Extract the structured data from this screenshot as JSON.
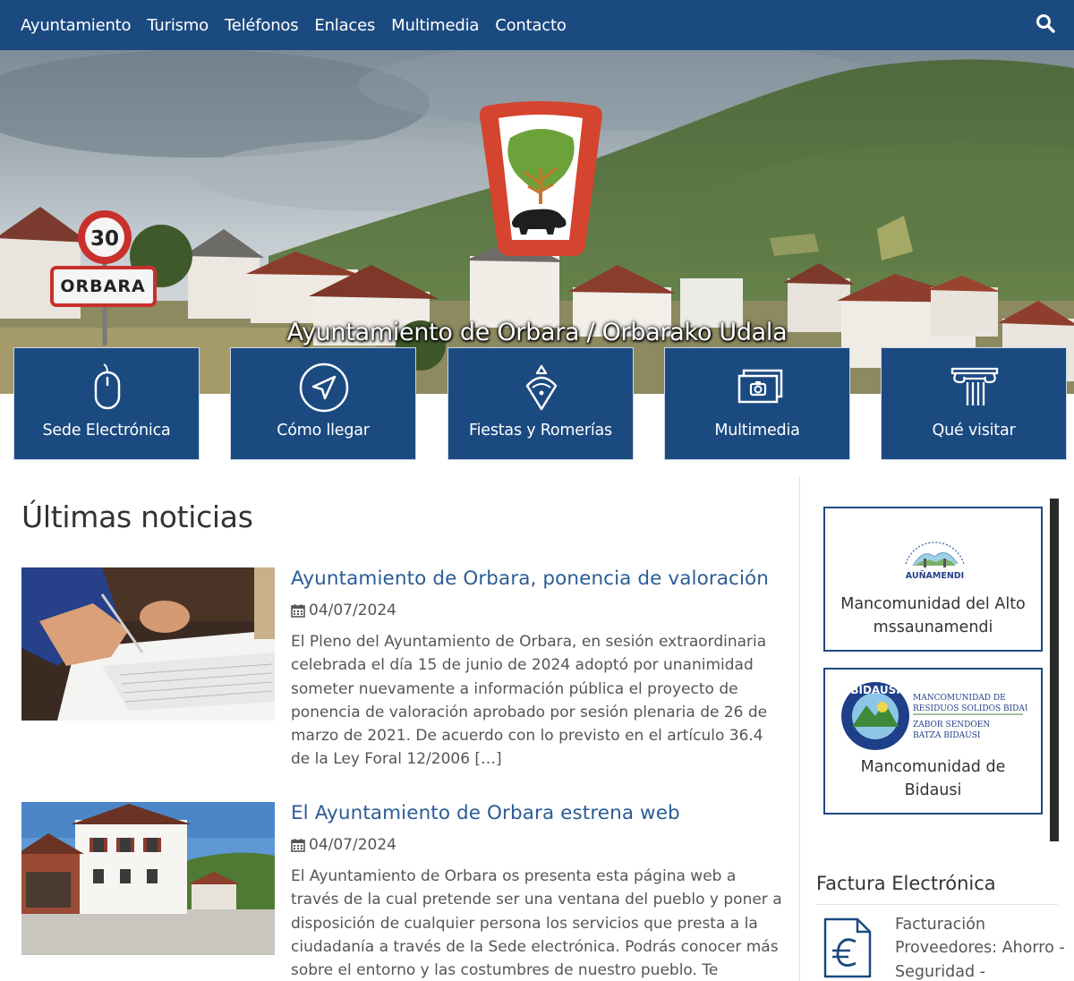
{
  "nav": {
    "items": [
      "Ayuntamiento",
      "Turismo",
      "Teléfonos",
      "Enlaces",
      "Multimedia",
      "Contacto"
    ],
    "search_icon": "search-icon"
  },
  "hero": {
    "title": "Ayuntamiento de Orbara / Orbarako Udala",
    "sign_speed": "30",
    "sign_town": "ORBARA",
    "shield_icon": "coat-of-arms-tree-boar"
  },
  "tiles": [
    {
      "label": "Sede Electrónica",
      "icon": "mouse-icon"
    },
    {
      "label": "Cómo llegar",
      "icon": "navigation-arrow-icon"
    },
    {
      "label": "Fiestas y Romerías",
      "icon": "handkerchief-icon"
    },
    {
      "label": "Multimedia",
      "icon": "photos-camera-icon"
    },
    {
      "label": "Qué visitar",
      "icon": "column-icon"
    }
  ],
  "main": {
    "title": "Últimas noticias"
  },
  "news": [
    {
      "title": "Ayuntamiento de Orbara, ponencia de valoración",
      "date": "04/07/2024",
      "excerpt": "El Pleno del Ayuntamiento de Orbara, en sesión extraordinaria celebrada el día 15 de junio de 2024 adoptó por unanimidad someter nuevamente a información pública el proyecto de ponencia de valoración aprobado por sesión plenaria de 26 de marzo de 2021. De acuerdo con lo previsto en el artículo 36.4 de la Ley Foral 12/2006 […]"
    },
    {
      "title": "El Ayuntamiento de Orbara estrena web",
      "date": "04/07/2024",
      "excerpt": "El Ayuntamiento de Orbara os presenta esta página web a través de la cual pretende ser una ventana del pueblo y poner a disposición de cualquier persona los servicios que presta a la ciudadanía a través de la Sede electrónica. Podrás conocer más sobre el entorno y las costumbres de nuestro pueblo. Te invitamos"
    }
  ],
  "sidebar": {
    "cards": [
      {
        "name_line1": "Mancomunidad del Alto",
        "name_line2": "mssaunamendi",
        "logo_text": "AUÑAMENDI"
      },
      {
        "name_line1": "Mancomunidad de",
        "name_line2": "Bidausi",
        "logo_ring": "BIDAUSI",
        "logo_lines": [
          "MANCOMUNIDAD DE",
          "RESIDUOS SOLIDOS BIDAUSI",
          "ZABOR SENDOEN",
          "BATZA BIDAUSI"
        ]
      }
    ],
    "factura_heading": "Factura Electrónica",
    "factura_text": "Facturación Proveedores: Ahorro - Seguridad - Beneficios"
  },
  "colors": {
    "primary": "#1b4a80",
    "link": "#2b5c96"
  }
}
